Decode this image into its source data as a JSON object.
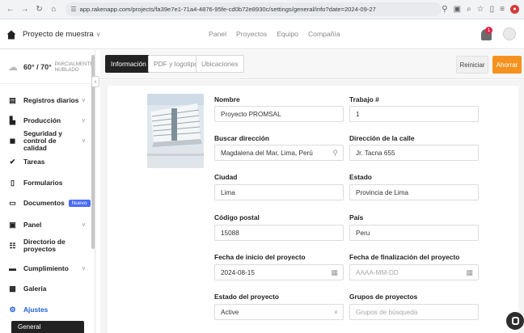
{
  "browser": {
    "url": "app.rakenapp.com/projects/fa39e7e1-71a4-4876-95fe-cd0b72e8930c/settings/general/info?date=2024-09-27"
  },
  "header": {
    "project_selector": "Proyecto de muestra",
    "nav": [
      "Panel",
      "Proyectos",
      "Equipo",
      "Compañía"
    ],
    "notification_count": "1"
  },
  "weather": {
    "temp": "60° / 70°",
    "condition_line1": "PARCIALMENTE",
    "condition_line2": "NUBLADO"
  },
  "sidebar": {
    "items": [
      {
        "label": "Registros diarios",
        "icon": "log-icon"
      },
      {
        "label": "Producción",
        "icon": "production-icon"
      },
      {
        "label": "Seguridad y control de calidad",
        "icon": "safety-icon"
      },
      {
        "label": "Tareas",
        "icon": "tasks-icon"
      },
      {
        "label": "Formularios",
        "icon": "forms-icon"
      },
      {
        "label": "Documentos",
        "icon": "folder-icon",
        "badge": "Nuevo"
      },
      {
        "label": "Panel",
        "icon": "chart-icon"
      },
      {
        "label": "Directorio de proyectos",
        "icon": "directory-icon"
      },
      {
        "label": "Cumplimiento",
        "icon": "compliance-icon"
      },
      {
        "label": "Galería",
        "icon": "gallery-icon"
      },
      {
        "label": "Ajustes",
        "icon": "gear-icon"
      }
    ],
    "sub_active": "General"
  },
  "tabs": {
    "info": "Información",
    "pdf": "PDF y logotipo",
    "locations": "Ubicaciones"
  },
  "actions": {
    "reset": "Reiniciar",
    "save": "Ahorrar"
  },
  "form": {
    "nombre": {
      "label": "Nombre",
      "value": "Proyecto PROMSAL"
    },
    "trabajo": {
      "label": "Trabajo #",
      "value": "1"
    },
    "buscar": {
      "label": "Buscar dirección",
      "value": "Magdalena del Mar, Lima, Perú"
    },
    "calle": {
      "label": "Dirección de la calle",
      "value": "Jr. Tacna 655"
    },
    "ciudad": {
      "label": "Ciudad",
      "value": "Lima"
    },
    "estado": {
      "label": "Estado",
      "value": "Provincia de Lima"
    },
    "postal": {
      "label": "Código postal",
      "value": "15088"
    },
    "pais": {
      "label": "País",
      "value": "Peru"
    },
    "inicio": {
      "label": "Fecha de inicio del proyecto",
      "value": "2024-08-15"
    },
    "fin": {
      "label": "Fecha de finalización del proyecto",
      "placeholder": "AAAA-MM-DD"
    },
    "estado_proyecto": {
      "label": "Estado del proyecto",
      "value": "Active"
    },
    "grupos": {
      "label": "Grupos de proyectos",
      "placeholder": "Grupos de búsqueda"
    }
  },
  "colors": {
    "accent_orange": "#f5921f",
    "dark": "#222222",
    "badge_blue": "#4a6cf7",
    "link_blue": "#1c5fd4"
  }
}
